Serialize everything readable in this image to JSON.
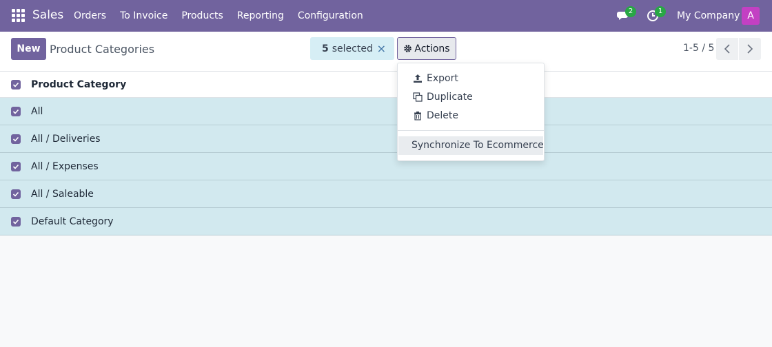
{
  "navbar": {
    "app_name": "Sales",
    "menu": [
      "Orders",
      "To Invoice",
      "Products",
      "Reporting",
      "Configuration"
    ],
    "messages_count": "2",
    "activities_count": "1",
    "company": "My Company",
    "avatar_initial": "A",
    "icons": {
      "apps": "apps-grid-icon",
      "messages": "chat-icon",
      "activities": "clock-icon"
    }
  },
  "control": {
    "new_label": "New",
    "title": "Product Categories",
    "selected_count": "5",
    "selected_label": "selected",
    "clear_icon": "×",
    "actions_label": "Actions",
    "pager_value": "1-5 / 5"
  },
  "list": {
    "header": "Product Category",
    "rows": [
      "All",
      "All / Deliveries",
      "All / Expenses",
      "All / Saleable",
      "Default Category"
    ]
  },
  "actions_menu": {
    "items": [
      "Export",
      "Duplicate",
      "Delete"
    ],
    "extra": "Synchronize To Ecommerce"
  },
  "colors": {
    "brand": "#71639e",
    "selected_row": "#d2e9ef",
    "badge": "#28a745",
    "avatar": "#c340c3"
  }
}
